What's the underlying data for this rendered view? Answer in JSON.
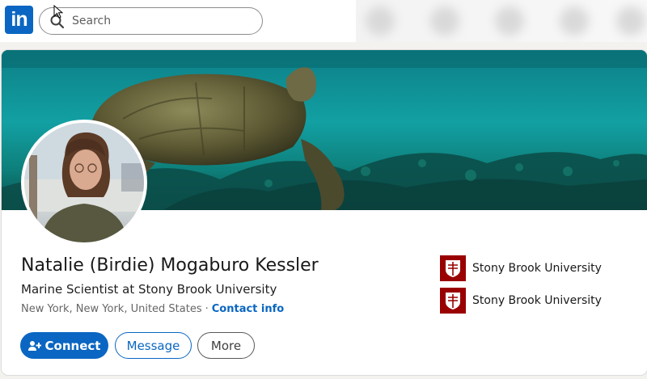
{
  "app": {
    "logo_text": "in",
    "brand_color": "#0a66c2"
  },
  "search": {
    "placeholder": "Search"
  },
  "profile": {
    "name": "Natalie (Birdie) Mogaburo Kessler",
    "headline": "Marine Scientist at Stony Brook University",
    "location": "New York, New York, United States",
    "separator": "·",
    "contact_link": "Contact info"
  },
  "actions": {
    "connect_label": "Connect",
    "message_label": "Message",
    "more_label": "More"
  },
  "education": [
    {
      "name": "Stony Brook University",
      "logo_color": "#990000"
    },
    {
      "name": "Stony Brook University",
      "logo_color": "#990000"
    }
  ],
  "icons": [
    "linkedin-logo",
    "search-icon",
    "cursor-icon",
    "add-person-icon",
    "school-logo"
  ]
}
